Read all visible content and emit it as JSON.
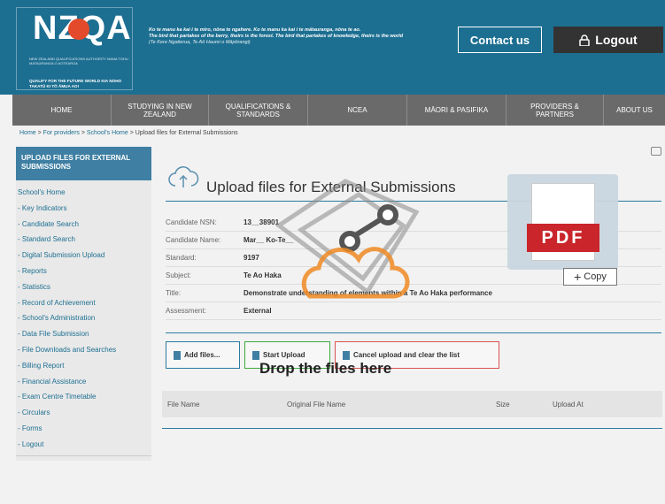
{
  "header": {
    "logo_text": "NZQA",
    "logo_org": "NEW ZEALAND QUALIFICATIONS AUTHORITY MANA TOHU MATAURANGA O AOTEAROA",
    "logo_tagline": "QUALIFY FOR THE FUTURE WORLD KIA NOHO TAKATŪ KI TŌ ĀMUA AO!",
    "motto_maori": "Ko te manu ka kai i te miro, nōna te ngahere. Ko te manu ka kai i te mātauranga, nōna te ao.",
    "motto_english": "The bird that partakes of the berry, theirs is the forest. The bird that partakes of knowledge, theirs is the world",
    "motto_credit": "(Te Kere Ngatierua, Te Aō Haumi o Māpōrangi)",
    "contact_label": "Contact us",
    "logout_label": "Logout"
  },
  "nav": [
    {
      "label": "HOME"
    },
    {
      "label": "STUDYING IN NEW ZEALAND"
    },
    {
      "label": "QUALIFICATIONS & STANDARDS"
    },
    {
      "label": "NCEA"
    },
    {
      "label": "MĀORI & PASIFIKA"
    },
    {
      "label": "PROVIDERS & PARTNERS"
    },
    {
      "label": "ABOUT US"
    }
  ],
  "breadcrumb": {
    "home": "Home",
    "sep": " > ",
    "providers": "For providers",
    "school_home": "School's Home",
    "current": "Upload files for External Submissions"
  },
  "sidebar": {
    "heading": "UPLOAD FILES FOR EXTERNAL SUBMISSIONS",
    "items": [
      "School's Home",
      "- Key Indicators",
      "- Candidate Search",
      "- Standard Search",
      "- Digital Submission Upload",
      "- Reports",
      "- Statistics",
      "- Record of Achievement",
      "- School's Administration",
      "- Data File Submission",
      "- File Downloads and Searches",
      "- Billing Report",
      "- Financial Assistance",
      "- Exam Centre Timetable",
      "- Circulars",
      "- Forms",
      "- Logout"
    ]
  },
  "main": {
    "title": "Upload files for External Submissions",
    "info": [
      {
        "label": "Candidate NSN:",
        "value": "13__38901"
      },
      {
        "label": "Candidate Name:",
        "value": "Mar__ Ko-Te__"
      },
      {
        "label": "Standard:",
        "value": "9197"
      },
      {
        "label": "Subject:",
        "value": "Te Ao Haka"
      },
      {
        "label": "Title:",
        "value": "Demonstrate understanding of elements within a Te Ao Haka performance"
      },
      {
        "label": "Assessment:",
        "value": "External"
      }
    ],
    "buttons": {
      "add_files": "Add files...",
      "start_upload": "Start Upload",
      "cancel": "Cancel upload and clear the list"
    },
    "drop_text": "Drop the files here",
    "file_table_headers": [
      "File Name",
      "Original File Name",
      "Size",
      "Upload At"
    ]
  },
  "drag": {
    "pdf_label": "PDF",
    "copy_label": "Copy"
  },
  "colors": {
    "header_blue": "#1d6f91",
    "nav_grey": "#6a6a6a",
    "sidebar_head": "#3e7fa3",
    "pdf_red": "#c9252b"
  }
}
